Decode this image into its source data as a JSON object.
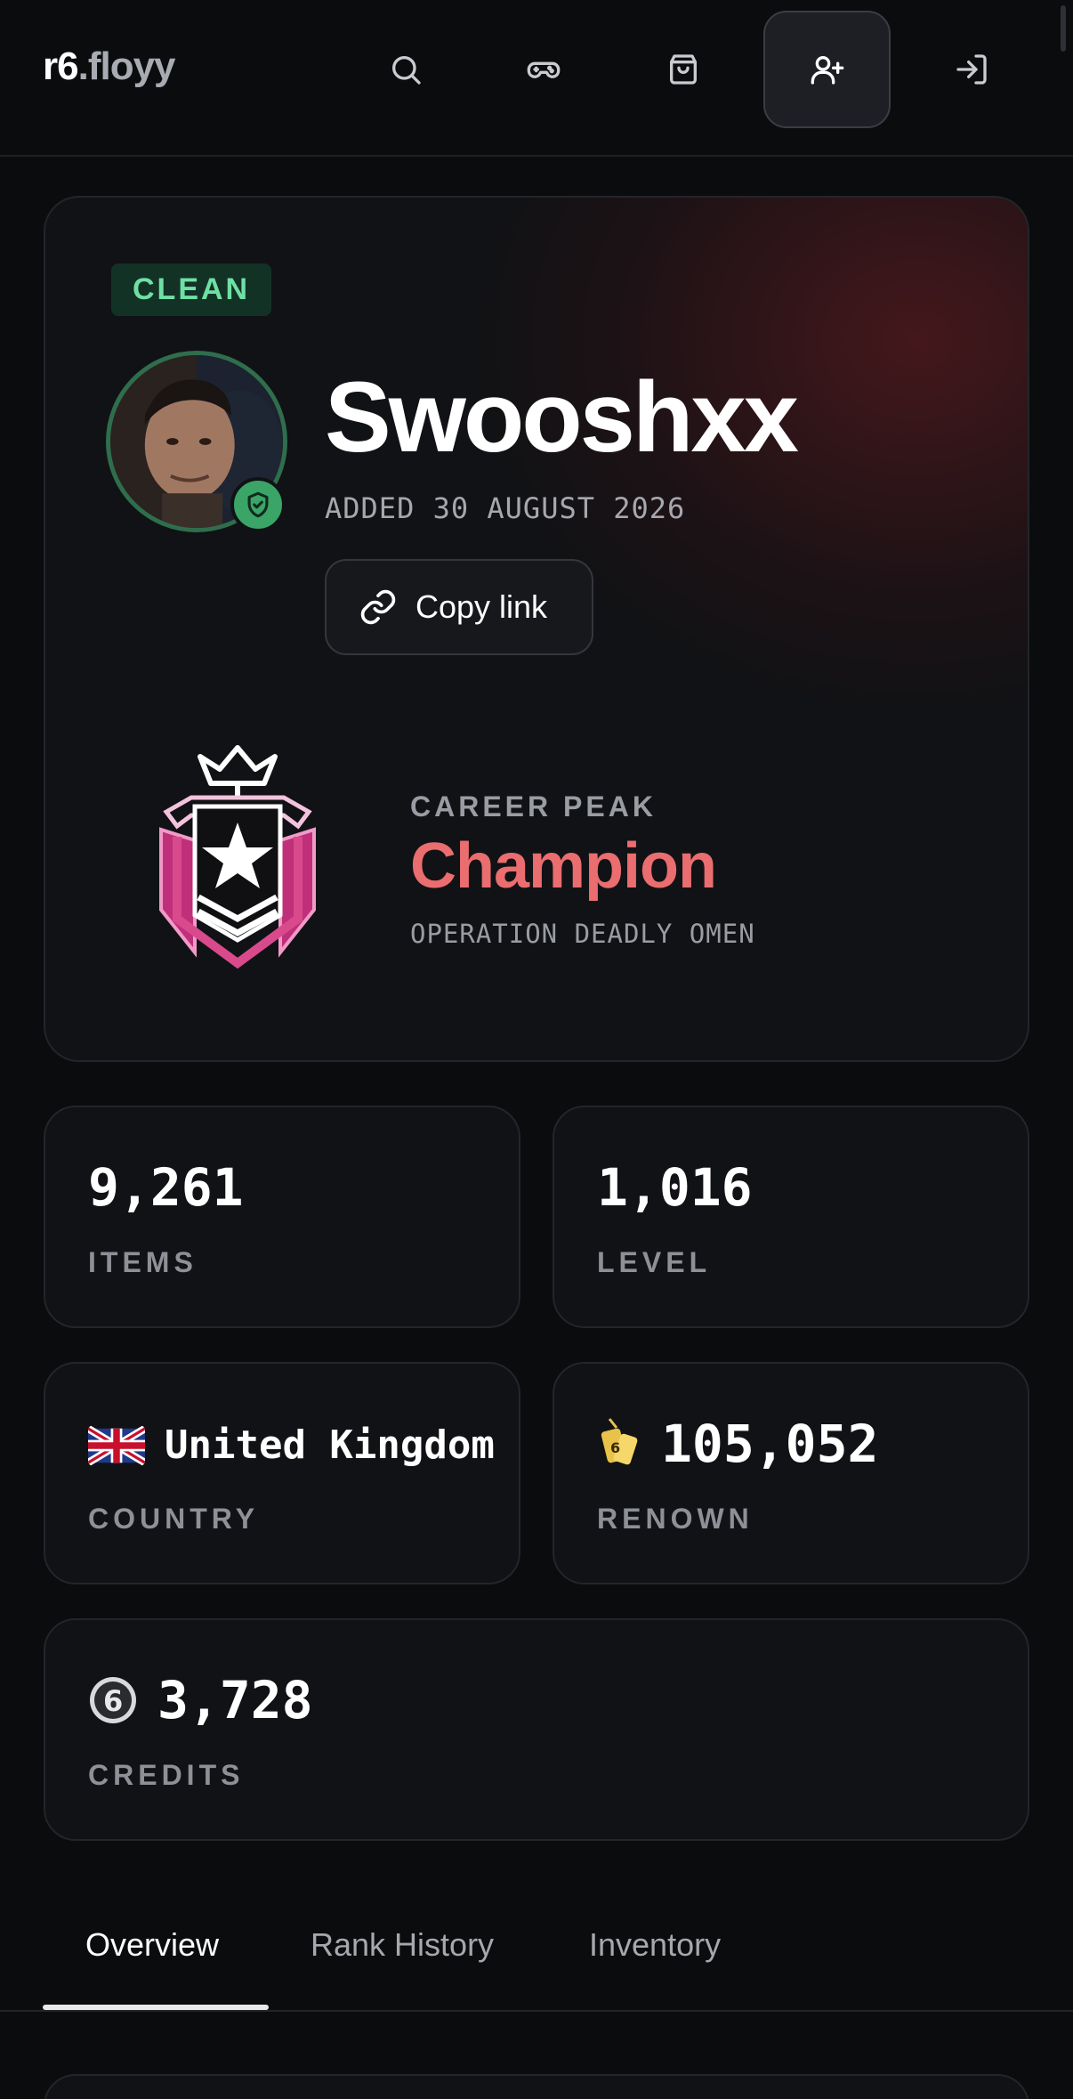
{
  "header": {
    "logo_main": "r6",
    "logo_suffix": ".floyy",
    "icons": [
      "search-icon",
      "gamepad-icon",
      "shopping-bag-icon",
      "add-user-icon",
      "login-icon"
    ],
    "active_icon": "add-user-icon"
  },
  "profile": {
    "status_badge": "CLEAN",
    "username": "Swooshxx",
    "added": "ADDED 30 AUGUST 2026",
    "copy_label": "Copy link",
    "career_peak_label": "CAREER PEAK",
    "career_peak_rank": "Champion",
    "career_peak_season": "OPERATION DEADLY OMEN"
  },
  "stats": {
    "items": {
      "value": "9,261",
      "label": "ITEMS"
    },
    "level": {
      "value": "1,016",
      "label": "LEVEL"
    },
    "country": {
      "value": "United Kingdom",
      "label": "COUNTRY",
      "icon": "uk-flag-icon"
    },
    "renown": {
      "value": "105,052",
      "label": "RENOWN",
      "icon": "renown-tag-icon"
    },
    "credits": {
      "value": "3,728",
      "label": "CREDITS",
      "icon": "r6-credits-icon"
    }
  },
  "tabs": [
    {
      "label": "Overview",
      "active": true
    },
    {
      "label": "Rank History",
      "active": false
    },
    {
      "label": "Inventory",
      "active": false
    }
  ],
  "colors": {
    "background": "#0b0c0e",
    "card": "#111215",
    "clean_badge_text": "#6fe0a4",
    "champion": "#ea6d6f",
    "verified_green": "#3aa567"
  }
}
